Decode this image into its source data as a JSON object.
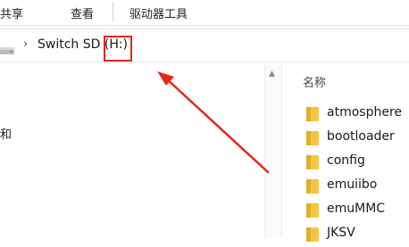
{
  "ribbon": {
    "tabs": [
      {
        "label": "共享"
      },
      {
        "label": "查看"
      },
      {
        "label": "驱动器工具"
      }
    ]
  },
  "address": {
    "crumb": "Switch SD (H:)"
  },
  "left_pane": {
    "partial_text": "和"
  },
  "files": {
    "column_name": "名称",
    "items": [
      {
        "name": "atmosphere"
      },
      {
        "name": "bootloader"
      },
      {
        "name": "config"
      },
      {
        "name": "emuiibo"
      },
      {
        "name": "emuMMC"
      },
      {
        "name": "JKSV"
      }
    ]
  },
  "colors": {
    "annotation_red": "#e8251a",
    "folder_yellow": "#f4c542"
  }
}
